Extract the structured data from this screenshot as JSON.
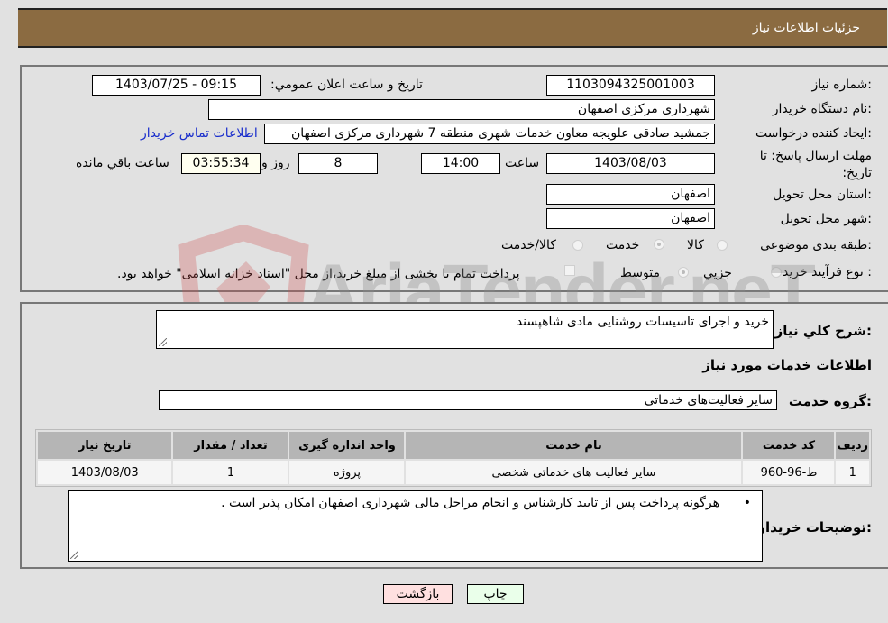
{
  "header": {
    "title": "جزئیات اطلاعات نیاز"
  },
  "fields": {
    "need_number_label": "شماره نیاز:",
    "need_number": "1103094325001003",
    "announce_label": "تاریخ و ساعت اعلان عمومي:",
    "announce_value": "1403/07/25 - 09:15",
    "buyer_org_label": "نام دستگاه خریدار:",
    "buyer_org": "شهرداری مرکزی اصفهان",
    "creator_label": "ایجاد کننده درخواست:",
    "creator": "جمشید صادقی علویجه معاون خدمات شهری منطقه 7 شهرداری مرکزی اصفهان",
    "contact_link": "اطلاعات تماس خریدار",
    "deadline_label": "مهلت ارسال پاسخ: تا تاریخ:",
    "deadline_date": "1403/08/03",
    "time_label": "ساعت",
    "deadline_time": "14:00",
    "days_value": "8",
    "days_label": "روز و",
    "remaining_time": "03:55:34",
    "remaining_label": "ساعت باقي مانده",
    "province_label": "استان محل تحویل:",
    "province": "اصفهان",
    "city_label": "شهر محل تحویل:",
    "city": "اصفهان",
    "category_label": "طبقه بندی موضوعی:",
    "category_options": [
      "کالا",
      "خدمت",
      "کالا/خدمت"
    ],
    "category_selected": "خدمت",
    "process_label": "نوع فرآیند خرید :",
    "process_options": [
      "جزیي",
      "متوسط"
    ],
    "process_selected": "متوسط",
    "treasury_note": "پرداخت تمام یا بخشی از مبلغ خرید،از محل \"اسناد خزانه اسلامی\" خواهد بود."
  },
  "details": {
    "summary_label": "شرح کلي نیاز:",
    "summary": "خرید و اجرای تاسیسات روشنایی مادی شاهپسند",
    "services_heading": "اطلاعات خدمات مورد نیاز",
    "service_group_label": "گروه خدمت:",
    "service_group": "سایر فعالیت‌های خدماتی",
    "table": {
      "headers": [
        "ردیف",
        "کد خدمت",
        "نام خدمت",
        "واحد اندازه گیری",
        "تعداد / مقدار",
        "تاریخ نیاز"
      ],
      "rows": [
        [
          "1",
          "ط-96-960",
          "سایر فعالیت های خدماتی شخصی",
          "پروژه",
          "1",
          "1403/08/03"
        ]
      ]
    },
    "buyer_notes_label": "توضیحات خریدار:",
    "buyer_notes": "هرگونه پرداخت پس از تایید کارشناس و انجام مراحل مالی شهرداری اصفهان امکان پذیر است ."
  },
  "buttons": {
    "print": "چاپ",
    "back": "بازگشت"
  },
  "watermark": "AriaTender.neT"
}
